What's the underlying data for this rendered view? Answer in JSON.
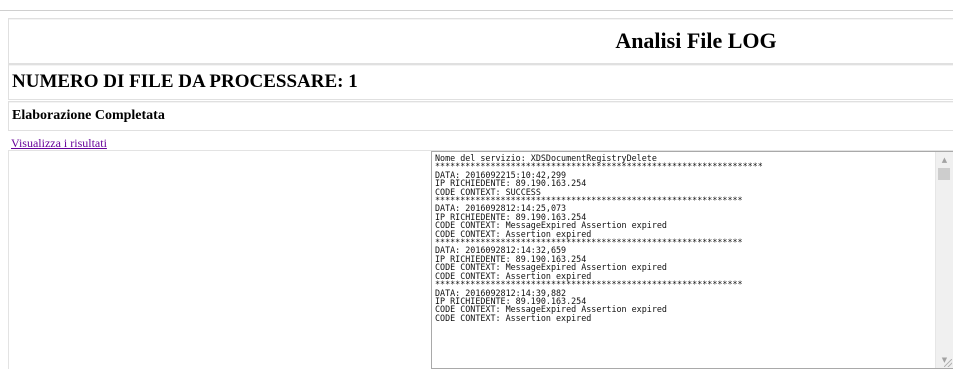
{
  "header": {
    "title": "Analisi File LOG"
  },
  "summary": {
    "files_to_process": "NUMERO DI FILE DA PROCESSARE: 1",
    "status": "Elaborazione Completata",
    "results_link": "Visualizza i risultati"
  },
  "log": {
    "content": "Nome del servizio: XDSDocumentRegistryDelete\n*****************************************************************\nDATA: 2016092215:10:42,299\nIP RICHIEDENTE: 89.190.163.254\nCODE CONTEXT: SUCCESS\n*************************************************************\nDATA: 2016092812:14:25,073\nIP RICHIEDENTE: 89.190.163.254\nCODE CONTEXT: MessageExpired Assertion expired\nCODE CONTEXT: Assertion expired\n*************************************************************\nDATA: 2016092812:14:32,659\nIP RICHIEDENTE: 89.190.163.254\nCODE CONTEXT: MessageExpired Assertion expired\nCODE CONTEXT: Assertion expired\n*************************************************************\nDATA: 2016092812:14:39,882\nIP RICHIEDENTE: 89.190.163.254\nCODE CONTEXT: MessageExpired Assertion expired\nCODE CONTEXT: Assertion expired",
    "scroll_up_glyph": "▲",
    "scroll_down_glyph": "▼"
  }
}
